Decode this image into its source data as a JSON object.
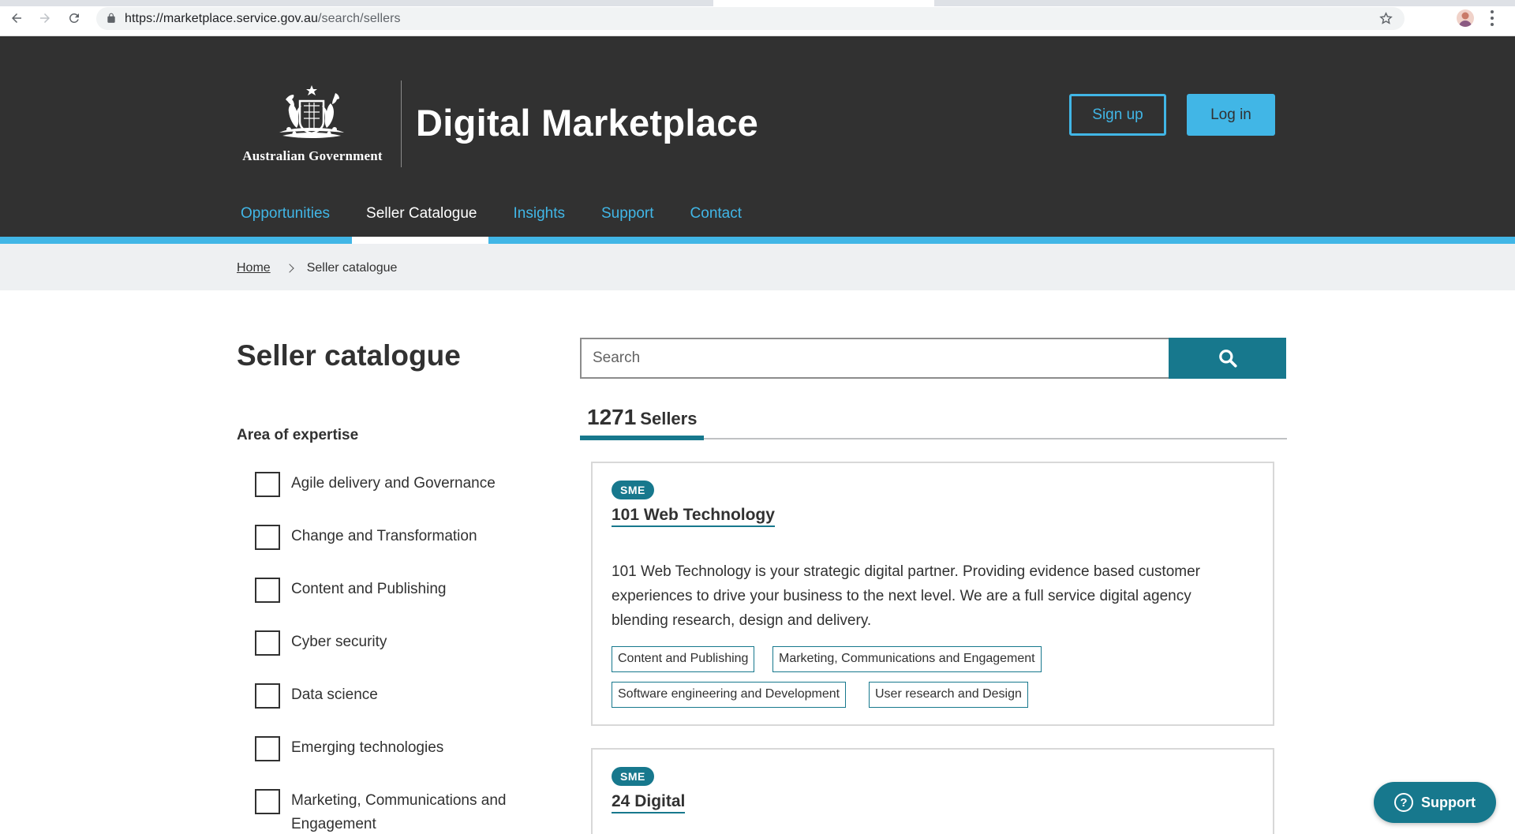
{
  "browser": {
    "url_host": "https://marketplace.service.gov.au",
    "url_path": "/search/sellers"
  },
  "header": {
    "gov_name": "Australian Government",
    "site_title": "Digital Marketplace",
    "signup_label": "Sign up",
    "login_label": "Log in",
    "nav": [
      {
        "label": "Opportunities",
        "active": false
      },
      {
        "label": "Seller Catalogue",
        "active": true
      },
      {
        "label": "Insights",
        "active": false
      },
      {
        "label": "Support",
        "active": false
      },
      {
        "label": "Contact",
        "active": false
      }
    ]
  },
  "breadcrumb": {
    "home": "Home",
    "current": "Seller catalogue"
  },
  "page": {
    "title": "Seller catalogue"
  },
  "filters": {
    "heading": "Area of expertise",
    "items": [
      "Agile delivery and Governance",
      "Change and Transformation",
      "Content and Publishing",
      "Cyber security",
      "Data science",
      "Emerging technologies",
      "Marketing, Communications and Engagement"
    ]
  },
  "search": {
    "placeholder": "Search"
  },
  "results": {
    "count": "1271",
    "unit": "Sellers"
  },
  "sellers": [
    {
      "badge": "SME",
      "name": "101 Web Technology",
      "description": "101 Web Technology is your strategic digital partner. Providing evidence based customer experiences to drive your business to the next level. We are a full service digital agency blending research, design and delivery.",
      "tags": [
        "Content and Publishing",
        "Marketing, Communications and Engagement",
        "Software engineering and Development",
        "User research and Design"
      ]
    },
    {
      "badge": "SME",
      "name": "24 Digital"
    }
  ],
  "support_widget": {
    "label": "Support"
  },
  "colors": {
    "header_bg": "#313131",
    "accent_light_blue": "#41b6e6",
    "accent_teal": "#17788d",
    "breadcrumb_bg": "#eef0f2"
  }
}
